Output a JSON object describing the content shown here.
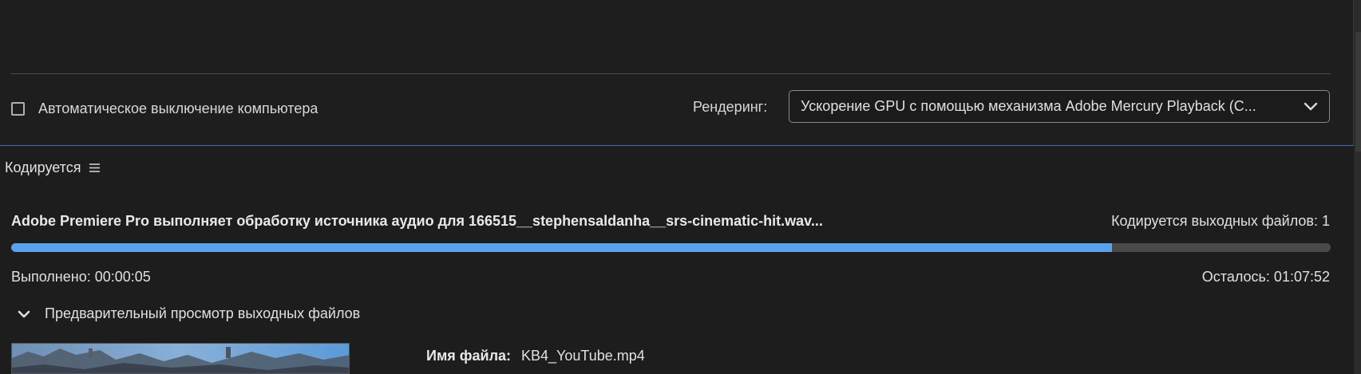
{
  "settings": {
    "auto_shutdown_label": "Автоматическое выключение компьютера",
    "auto_shutdown_checked": false,
    "rendering_label": "Рендеринг:",
    "rendering_value": "Ускорение GPU с помощью механизма Adobe Mercury Playback (C..."
  },
  "encoding": {
    "panel_title": "Кодируется",
    "status_text": "Adobe Premiere Pro выполняет обработку источника аудио для 166515__stephensaldanha__srs-cinematic-hit.wav...",
    "output_count": "Кодируется выходных файлов: 1",
    "progress_fraction": 0.834,
    "elapsed": "Выполнено: 00:00:05",
    "remaining": "Осталось: 01:07:52",
    "preview_toggle_label": "Предварительный просмотр выходных файлов",
    "file_name_label": "Имя файла:",
    "file_name_value": "KB4_YouTube.mp4"
  },
  "colors": {
    "progress_fill": "#5aa2ee",
    "progress_track": "#4a4a4a",
    "panel_bg": "#1d1d1d",
    "focus_border": "#3d6fb0"
  }
}
